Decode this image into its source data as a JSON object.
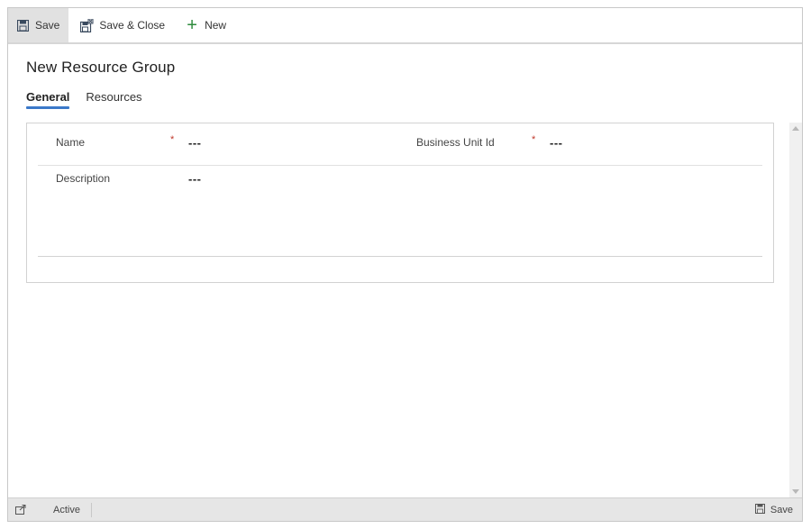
{
  "toolbar": {
    "save_label": "Save",
    "save_close_label": "Save & Close",
    "new_label": "New"
  },
  "header": {
    "title": "New Resource Group"
  },
  "tabs": [
    {
      "label": "General",
      "active": true
    },
    {
      "label": "Resources",
      "active": false
    }
  ],
  "form": {
    "name": {
      "label": "Name",
      "required_mark": "*",
      "value": "---"
    },
    "business_unit": {
      "label": "Business Unit Id",
      "required_mark": "*",
      "value": "---"
    },
    "description": {
      "label": "Description",
      "value": "---"
    }
  },
  "footer": {
    "status": "Active",
    "save_label": "Save"
  },
  "colors": {
    "accent": "#3b79c9",
    "required": "#c0392b",
    "new_plus": "#2e8b3d",
    "active_command_bg": "#e1e1e1"
  },
  "icons": {
    "save": "save-icon",
    "save_close": "save-close-icon",
    "new": "plus-icon",
    "popout": "popout-icon"
  }
}
